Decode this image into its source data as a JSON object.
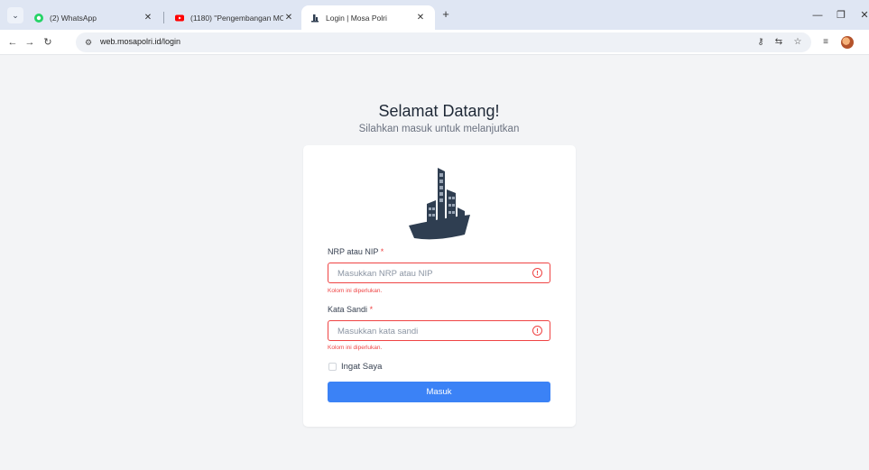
{
  "browser": {
    "tabs": [
      {
        "title": "(2) WhatsApp",
        "icon": "whatsapp-icon",
        "color": "#25d366",
        "active": false
      },
      {
        "title": "(1180) \"Pengembangan MOSA",
        "icon": "youtube-icon",
        "color": "#ff0000",
        "active": false
      },
      {
        "title": "Login | Mosa Polri",
        "icon": "building-favicon",
        "active": true
      }
    ],
    "url": "web.mosapolri.id/login"
  },
  "page": {
    "heading": "Selamat Datang!",
    "subheading": "Silahkan masuk untuk melanjutkan"
  },
  "form": {
    "username": {
      "label": "NRP atau NIP",
      "required_mark": "*",
      "placeholder": "Masukkan NRP atau NIP",
      "value": "",
      "error": "Kolom ini diperlukan."
    },
    "password": {
      "label": "Kata Sandi",
      "required_mark": "*",
      "placeholder": "Masukkan kata sandi",
      "value": "",
      "error": "Kolom ini diperlukan."
    },
    "remember_label": "Ingat Saya",
    "remember_checked": false,
    "submit_label": "Masuk"
  },
  "colors": {
    "accent": "#3b82f6",
    "error": "#ef4444",
    "logo_dark": "#2f3e51"
  }
}
